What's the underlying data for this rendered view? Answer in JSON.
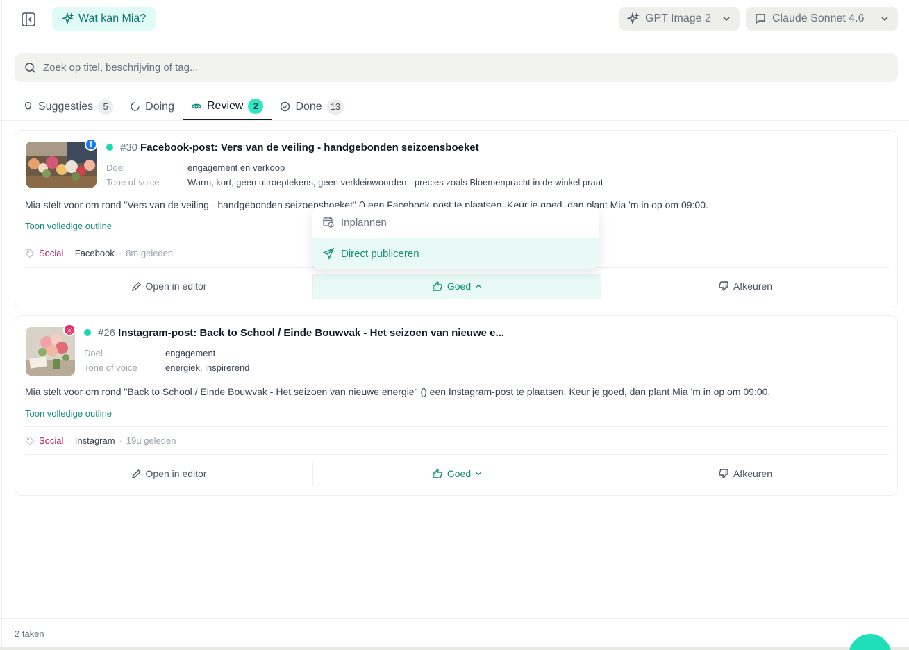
{
  "header": {
    "mia_label": "Wat kan Mia?",
    "image_model": "GPT Image 2",
    "text_model": "Claude Sonnet 4.6"
  },
  "search": {
    "placeholder": "Zoek op titel, beschrijving of tag..."
  },
  "tabs": [
    {
      "label": "Suggesties",
      "count": "5"
    },
    {
      "label": "Doing",
      "count": ""
    },
    {
      "label": "Review",
      "count": "2"
    },
    {
      "label": "Done",
      "count": "13"
    }
  ],
  "cards": [
    {
      "number": "#30",
      "title": "Facebook-post: Vers van de veiling - handgebonden seizoensboeket",
      "platform_badge": "f",
      "doel_label": "Doel",
      "doel": "engagement en verkoop",
      "tone_label": "Tone of voice",
      "tone": "Warm, kort, geen uitroeptekens, geen verkleinwoorden - precies zoals Bloemenpracht in de winkel praat",
      "description": "Mia stelt voor om rond \"Vers van de veiling - handgebonden seizoensboeket\" () een Facebook-post te plaatsen. Keur je goed, dan plant Mia 'm in op om 09:00.",
      "outline_link": "Toon volledige outline",
      "tag": "Social",
      "platform": "Facebook",
      "time": "8m geleden",
      "edit_label": "Open in editor",
      "approve_label": "Goed",
      "reject_label": "Afkeuren"
    },
    {
      "number": "#26",
      "title": "Instagram-post: Back to School / Einde Bouwvak - Het seizoen van nieuwe e...",
      "platform_badge": "◎",
      "doel_label": "Doel",
      "doel": "engagement",
      "tone_label": "Tone of voice",
      "tone": "energiek, inspirerend",
      "description": "Mia stelt voor om rond \"Back to School / Einde Bouwvak - Het seizoen van nieuwe energie\" () een Instagram-post te plaatsen. Keur je goed, dan plant Mia 'm in op om 09:00.",
      "outline_link": "Toon volledige outline",
      "tag": "Social",
      "platform": "Instagram",
      "time": "19u geleden",
      "edit_label": "Open in editor",
      "approve_label": "Goed",
      "reject_label": "Afkeuren"
    }
  ],
  "dropdown": {
    "schedule": "Inplannen",
    "publish": "Direct publiceren"
  },
  "footer": {
    "count_text": "2 taken"
  },
  "colors": {
    "accent": "#1fdfb9",
    "accent_text": "#0f8f7a",
    "tag_social": "#c2185b",
    "facebook": "#1877f2",
    "instagram": "#e1306c"
  }
}
